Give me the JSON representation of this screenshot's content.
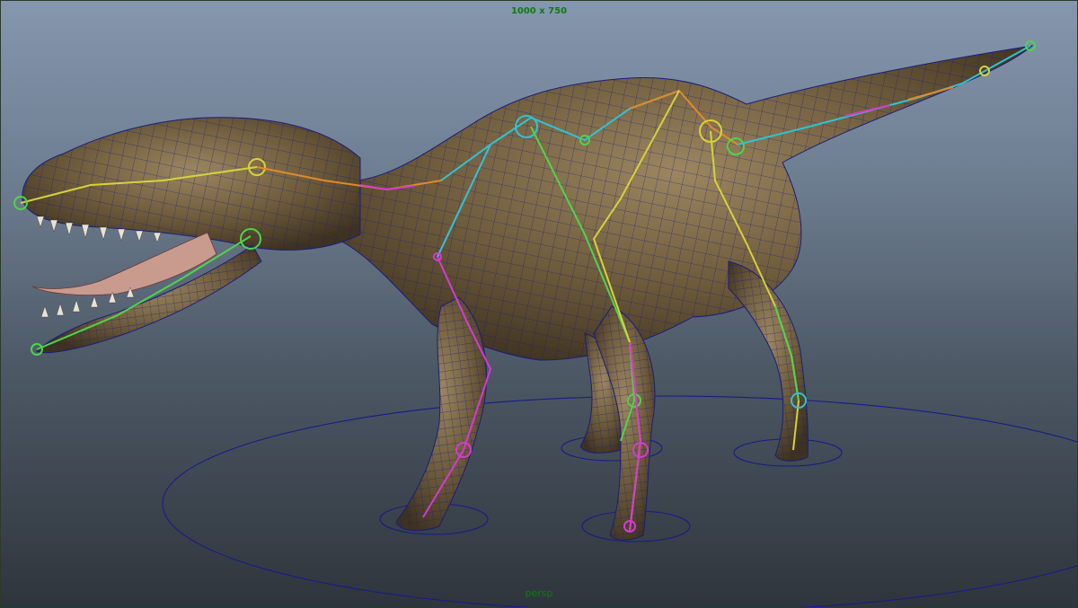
{
  "viewport": {
    "resolution_gate_label": "1000 x 750",
    "camera_label": "persp"
  },
  "scene": {
    "subject": "dinosaur-mesh-with-skeleton-rig",
    "colors": {
      "bg_top": "#8597ae",
      "bg_bottom": "#2f353c",
      "wireframe": "#1a1e7a",
      "skin": "#6e5b3b",
      "skin_light": "#a08a62",
      "label_green": "#0f7a10",
      "bone_cyan": "#2ec4d4",
      "bone_yellow": "#d6d23a",
      "bone_orange": "#e08a2a",
      "bone_magenta": "#d63ad0",
      "bone_green": "#4fd44a",
      "control_circle": "#1a1a8a"
    }
  }
}
